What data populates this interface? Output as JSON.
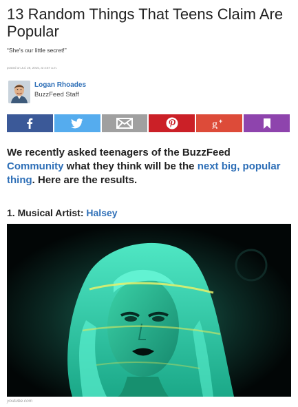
{
  "article": {
    "title": "13 Random Things That Teens Claim Are Popular",
    "subtitle": "“She's our little secret!”",
    "posted": "posted on Jul. 28, 2015, at 4:57 a.m."
  },
  "author": {
    "name": "Logan Rhoades",
    "role": "BuzzFeed Staff"
  },
  "share": [
    {
      "network": "facebook",
      "icon": "facebook-icon",
      "color": "#3b5998"
    },
    {
      "network": "twitter",
      "icon": "twitter-icon",
      "color": "#55acee"
    },
    {
      "network": "email",
      "icon": "email-icon",
      "color": "#a0a0a0"
    },
    {
      "network": "pinterest",
      "icon": "pinterest-icon",
      "color": "#cb2027"
    },
    {
      "network": "google-plus",
      "icon": "google-plus-icon",
      "color": "#dd4b39"
    },
    {
      "network": "bookmark",
      "icon": "bookmark-icon",
      "color": "#8e44ad"
    }
  ],
  "intro": {
    "part1": "We recently asked teenagers of the BuzzFeed ",
    "link1": "Community",
    "part2": " what they think will be the ",
    "link2": "next big, popular thing",
    "part3": ". Here are the results."
  },
  "item1": {
    "label": "1. Musical Artist: ",
    "link": "Halsey"
  },
  "image": {
    "credit": "youtube.com",
    "accent": "#1fd6a8"
  }
}
